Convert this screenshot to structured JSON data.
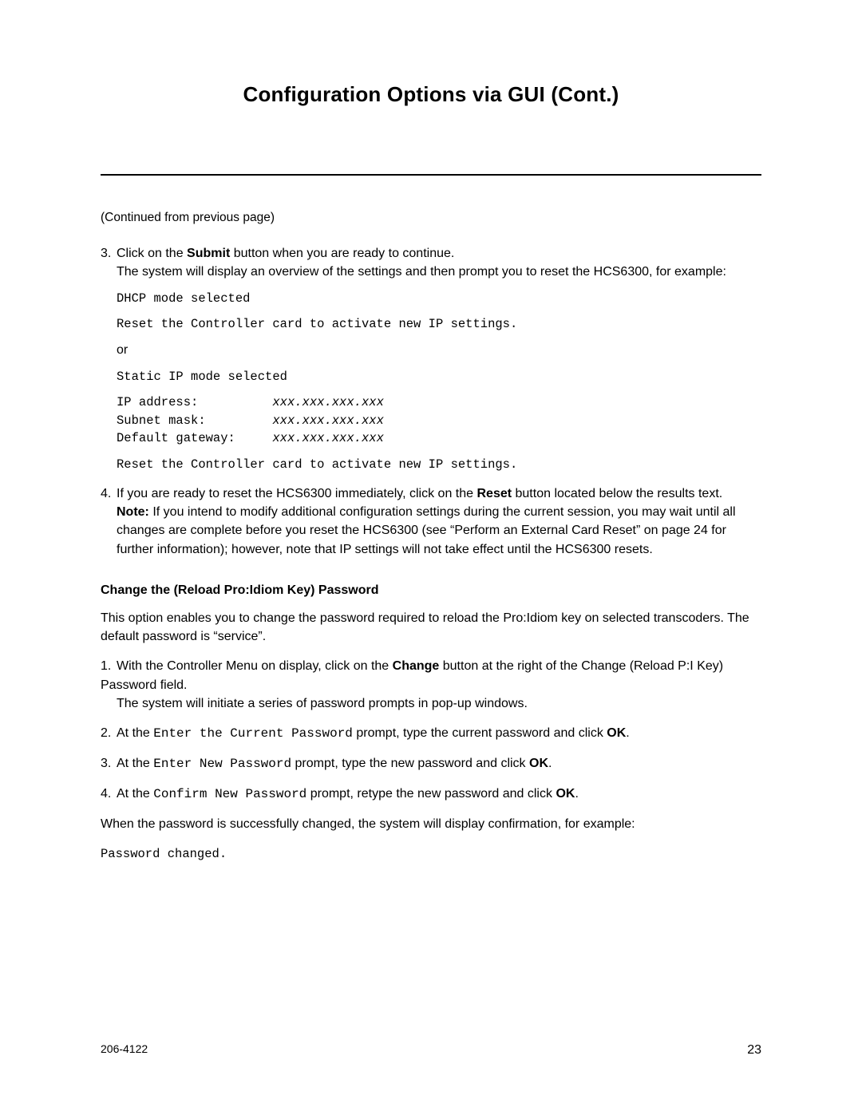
{
  "title": "Configuration Options via GUI (Cont.)",
  "continued": "(Continued from previous page)",
  "step3": {
    "num": "3.",
    "line1_a": "Click on the ",
    "line1_b": "Submit",
    "line1_c": " button when you are ready to continue.",
    "line2": "The system will display an overview of the settings and then prompt you to reset the HCS6300, for example:",
    "code1a": "DHCP mode selected",
    "code1b": "Reset the Controller card to activate new IP settings.",
    "or": "or",
    "code2a": "Static IP mode selected",
    "code2b": "IP address:          ",
    "code2b_it": "xxx.xxx.xxx.xxx",
    "code2c": "Subnet mask:         ",
    "code2c_it": "xxx.xxx.xxx.xxx",
    "code2d": "Default gateway:     ",
    "code2d_it": "xxx.xxx.xxx.xxx",
    "code2e": "Reset the Controller card to activate new IP settings."
  },
  "step4": {
    "num": "4.",
    "line1_a": "If you are ready to reset the HCS6300 immediately, click on the ",
    "line1_b": "Reset",
    "line1_c": " button located below the results text.",
    "note_a": "Note:",
    "note_b": " If you intend to modify additional configuration settings during the current session, you may wait until all changes are complete before you reset the HCS6300 (see “Perform an External Card Reset” on page 24 for further information); however, note that IP settings will not take effect until the HCS6300 resets."
  },
  "section2": {
    "heading": "Change the (Reload Pro:Idiom Key) Password",
    "intro": "This option enables you to change the password required to reload the Pro:Idiom key on selected transcoders. The default password is “service”.",
    "s1": {
      "num": "1.",
      "a": "With the Controller Menu on display, click on the ",
      "b": "Change",
      "c": " button at the right of the Change (Reload P:I Key) Password field.",
      "d": "The system will initiate a series of password prompts in pop-up windows."
    },
    "s2": {
      "num": "2.",
      "a": "At the ",
      "code": "Enter the Current Password",
      "b": " prompt, type the current password and click ",
      "ok": "OK",
      "c": "."
    },
    "s3": {
      "num": "3.",
      "a": "At the ",
      "code": "Enter New Password",
      "b": " prompt, type the new password and click ",
      "ok": "OK",
      "c": "."
    },
    "s4": {
      "num": "4.",
      "a": "At the ",
      "code": "Confirm New Password",
      "b": " prompt, retype the new password and click ",
      "ok": "OK",
      "c": "."
    },
    "outro": "When the password is successfully changed, the system will display confirmation, for example:",
    "codeOut": "Password changed."
  },
  "footer": {
    "left": "206-4122",
    "right": "23"
  }
}
